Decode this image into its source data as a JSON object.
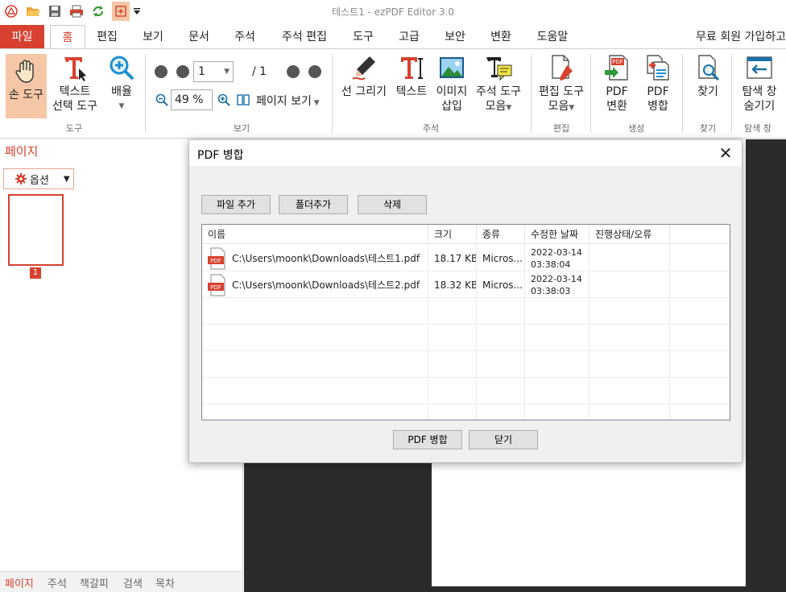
{
  "window": {
    "title": "테스트1 - ezPDF Editor 3.0"
  },
  "quick_access": [
    "app-logo-icon",
    "open-folder-icon",
    "save-icon",
    "print-icon",
    "refresh-icon",
    "merge-icon",
    "customize-icon"
  ],
  "tabs": [
    "파일",
    "홈",
    "편집",
    "보기",
    "문서",
    "주석",
    "주석 편집",
    "도구",
    "고급",
    "보안",
    "변환",
    "도움말"
  ],
  "signup": "무료 회원 가입하고",
  "ribbon": {
    "hand_tool": "손 도구",
    "text_select_1": "텍스트",
    "text_select_2": "선택 도구",
    "zoom": "배율",
    "group_tools": "도구",
    "page_value": "1",
    "page_total": "/ 1",
    "zoom_value": "49 %",
    "page_view": "페이지 보기",
    "group_view": "보기",
    "draw_line": "선 그리기",
    "text": "텍스트",
    "insert_image_1": "이미지",
    "insert_image_2": "삽입",
    "annot_tools_1": "주석 도구",
    "annot_tools_2": "모음",
    "group_annot": "주석",
    "edit_tools_1": "편집 도구",
    "edit_tools_2": "모음",
    "group_edit": "편집",
    "pdf_convert_1": "PDF",
    "pdf_convert_2": "변환",
    "pdf_merge_1": "PDF",
    "pdf_merge_2": "병합",
    "group_create": "생성",
    "find": "찾기",
    "group_find": "찾기",
    "nav_window_1": "탐색 창",
    "nav_window_2": "숨기기",
    "group_nav": "탐색 창"
  },
  "left_panel": {
    "title": "페이지",
    "options": "옵션",
    "thumb_number": "1",
    "bottom_tabs": [
      "페이지",
      "주석",
      "책갈피",
      "검색",
      "목차"
    ]
  },
  "dialog": {
    "title": "PDF 병합",
    "add_file": "파일 추가",
    "add_folder": "폴더추가",
    "delete": "삭제",
    "columns": [
      "이름",
      "크기",
      "종류",
      "수정한 날짜",
      "진행상태/오류"
    ],
    "rows": [
      {
        "name": "C:\\Users\\moonk\\Downloads\\테스트1.pdf",
        "size": "18.17 KB",
        "type": "Micros...",
        "date": "2022-03-14",
        "time": "03:38:04",
        "status": ""
      },
      {
        "name": "C:\\Users\\moonk\\Downloads\\테스트2.pdf",
        "size": "18.32 KB",
        "type": "Micros...",
        "date": "2022-03-14",
        "time": "03:38:03",
        "status": ""
      }
    ],
    "merge_button": "PDF 병합",
    "close_button": "닫기"
  },
  "colors": {
    "accent": "#d8412f",
    "selection": "#f6c7a6",
    "doc_background": "#2b2b2b"
  }
}
